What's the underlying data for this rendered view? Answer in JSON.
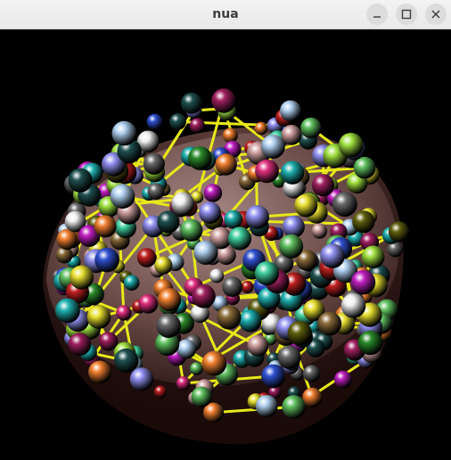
{
  "window": {
    "title": "nua",
    "controls": {
      "minimize_icon": "minimize-icon",
      "maximize_icon": "maximize-icon",
      "close_icon": "close-icon"
    }
  },
  "scene": {
    "background": "#000000",
    "bowl_color": "#7a5a56",
    "bond_color": "#e8e81a",
    "atom_palette": [
      "#e8e030",
      "#2a8a2a",
      "#c02020",
      "#3050d0",
      "#20b0b0",
      "#c020c0",
      "#f0f0f0",
      "#8a6a3a",
      "#a0e040",
      "#e03080",
      "#6a6a6a",
      "#40d0a0",
      "#f08030",
      "#9090f0",
      "#d0a0a0",
      "#606010",
      "#60c060",
      "#205050",
      "#a02060",
      "#b0d0f0"
    ]
  }
}
